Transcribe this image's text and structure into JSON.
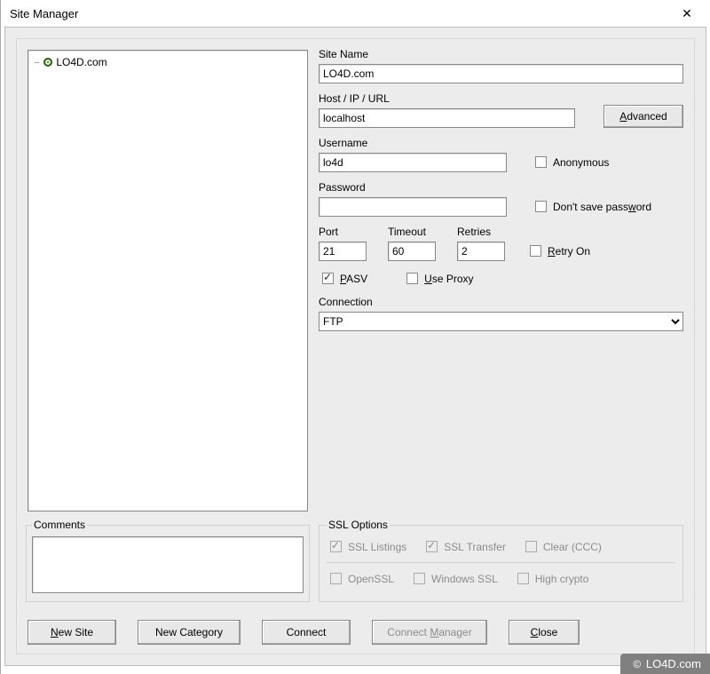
{
  "title": "Site Manager",
  "tree": {
    "site": "LO4D.com"
  },
  "comments": {
    "legend": "Comments",
    "value": ""
  },
  "form": {
    "site_name": {
      "label": "Site Name",
      "value": "LO4D.com"
    },
    "host": {
      "label": "Host / IP / URL",
      "value": "localhost"
    },
    "advanced": "Advanced",
    "username": {
      "label": "Username",
      "value": "lo4d"
    },
    "anonymous": {
      "label": "Anonymous",
      "checked": false
    },
    "password": {
      "label": "Password",
      "value": ""
    },
    "dontsave": {
      "label": "Don't save password",
      "checked": false
    },
    "port": {
      "label": "Port",
      "value": "21"
    },
    "timeout": {
      "label": "Timeout",
      "value": "60"
    },
    "retries": {
      "label": "Retries",
      "value": "2"
    },
    "retry_on": {
      "label": "Retry On",
      "checked": false
    },
    "pasv": {
      "label": "PASV",
      "checked": true
    },
    "use_proxy": {
      "label": "Use Proxy",
      "checked": false
    },
    "connection": {
      "label": "Connection",
      "value": "FTP"
    }
  },
  "ssl": {
    "legend": "SSL Options",
    "listings": {
      "label": "SSL Listings",
      "checked": true
    },
    "transfer": {
      "label": "SSL Transfer",
      "checked": true
    },
    "clear": {
      "label": "Clear (CCC)",
      "checked": false
    },
    "openssl": {
      "label": "OpenSSL",
      "checked": false
    },
    "winssl": {
      "label": "Windows SSL",
      "checked": false
    },
    "highcrypto": {
      "label": "High crypto",
      "checked": false
    }
  },
  "buttons": {
    "new_site": "New Site",
    "new_category": "New Category",
    "connect": "Connect",
    "connect_mgr": "Connect Manager",
    "close": "Close"
  },
  "watermark": "LO4D.com"
}
